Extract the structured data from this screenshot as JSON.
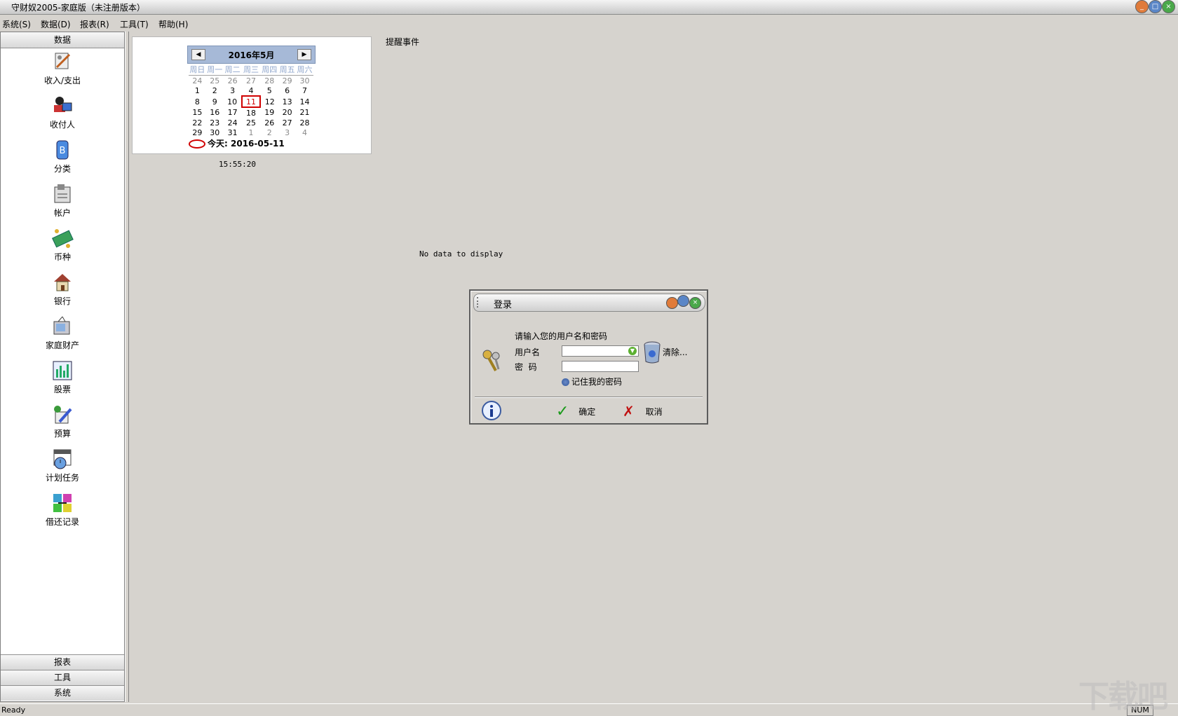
{
  "window": {
    "title": "守财奴2005-家庭版（未注册版本）"
  },
  "menu": [
    "系统(S)",
    "数据(D)",
    "报表(R)",
    "工具(T)",
    "帮助(H)"
  ],
  "sidebar": {
    "header": "数据",
    "items": [
      {
        "label": "收入/支出",
        "icon": "income-expense-icon"
      },
      {
        "label": "收付人",
        "icon": "payee-icon"
      },
      {
        "label": "分类",
        "icon": "category-icon"
      },
      {
        "label": "帐户",
        "icon": "account-icon"
      },
      {
        "label": "币种",
        "icon": "currency-icon"
      },
      {
        "label": "银行",
        "icon": "bank-icon"
      },
      {
        "label": "家庭财产",
        "icon": "home-asset-icon"
      },
      {
        "label": "股票",
        "icon": "stock-icon"
      },
      {
        "label": "预算",
        "icon": "budget-icon"
      },
      {
        "label": "计划任务",
        "icon": "scheduled-task-icon"
      },
      {
        "label": "借还记录",
        "icon": "loan-record-icon"
      }
    ],
    "bottom_groups": [
      "报表",
      "工具",
      "系统"
    ]
  },
  "calendar": {
    "month_title": "2016年5月",
    "weekdays": [
      "周日",
      "周一",
      "周二",
      "周三",
      "周四",
      "周五",
      "周六"
    ],
    "weeks": [
      [
        "24",
        "25",
        "26",
        "27",
        "28",
        "29",
        "30"
      ],
      [
        "1",
        "2",
        "3",
        "4",
        "5",
        "6",
        "7"
      ],
      [
        "8",
        "9",
        "10",
        "11",
        "12",
        "13",
        "14"
      ],
      [
        "15",
        "16",
        "17",
        "18",
        "19",
        "20",
        "21"
      ],
      [
        "22",
        "23",
        "24",
        "25",
        "26",
        "27",
        "28"
      ],
      [
        "29",
        "30",
        "31",
        "1",
        "2",
        "3",
        "4"
      ]
    ],
    "today_value": "11",
    "today_label": "今天:",
    "today_date": "2016-05-11"
  },
  "clock": "15:55:20",
  "reminder": {
    "title": "提醒事件",
    "empty_text": "No data to display"
  },
  "login_dialog": {
    "title": "登录",
    "prompt": "请输入您的用户名和密码",
    "username_label": "用户名",
    "password_label": "密  码",
    "clear_label": "清除...",
    "remember_label": "记住我的密码",
    "ok_label": "确定",
    "cancel_label": "取消",
    "username_value": "",
    "password_value": ""
  },
  "statusbar": {
    "status": "Ready",
    "num": "NUM"
  },
  "watermark": {
    "text": "下载吧"
  },
  "colors": {
    "background": "#d6d3ce",
    "calendar_header": "#a6b9d7",
    "today_ring": "#d00000"
  }
}
